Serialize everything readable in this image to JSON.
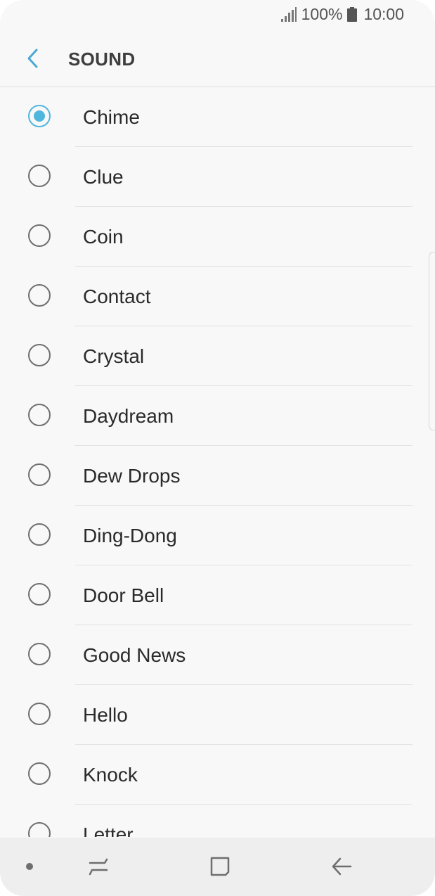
{
  "status_bar": {
    "battery": "100%",
    "time": "10:00",
    "icons": [
      "signal-icon",
      "battery-icon"
    ]
  },
  "header": {
    "title": "SOUND",
    "back_icon": "chevron-left-icon"
  },
  "sounds": [
    {
      "label": "Chime",
      "selected": true
    },
    {
      "label": "Clue",
      "selected": false
    },
    {
      "label": "Coin",
      "selected": false
    },
    {
      "label": "Contact",
      "selected": false
    },
    {
      "label": "Crystal",
      "selected": false
    },
    {
      "label": "Daydream",
      "selected": false
    },
    {
      "label": "Dew Drops",
      "selected": false
    },
    {
      "label": "Ding-Dong",
      "selected": false
    },
    {
      "label": "Door Bell",
      "selected": false
    },
    {
      "label": "Good News",
      "selected": false
    },
    {
      "label": "Hello",
      "selected": false
    },
    {
      "label": "Knock",
      "selected": false
    },
    {
      "label": "Letter",
      "selected": false
    }
  ],
  "nav_bar": {
    "icons": [
      "dot-icon",
      "recent-apps-icon",
      "home-icon",
      "back-arrow-icon"
    ]
  },
  "colors": {
    "accent": "#4fb7dd",
    "background": "#f8f8f8",
    "nav_background": "#eeeeee"
  }
}
